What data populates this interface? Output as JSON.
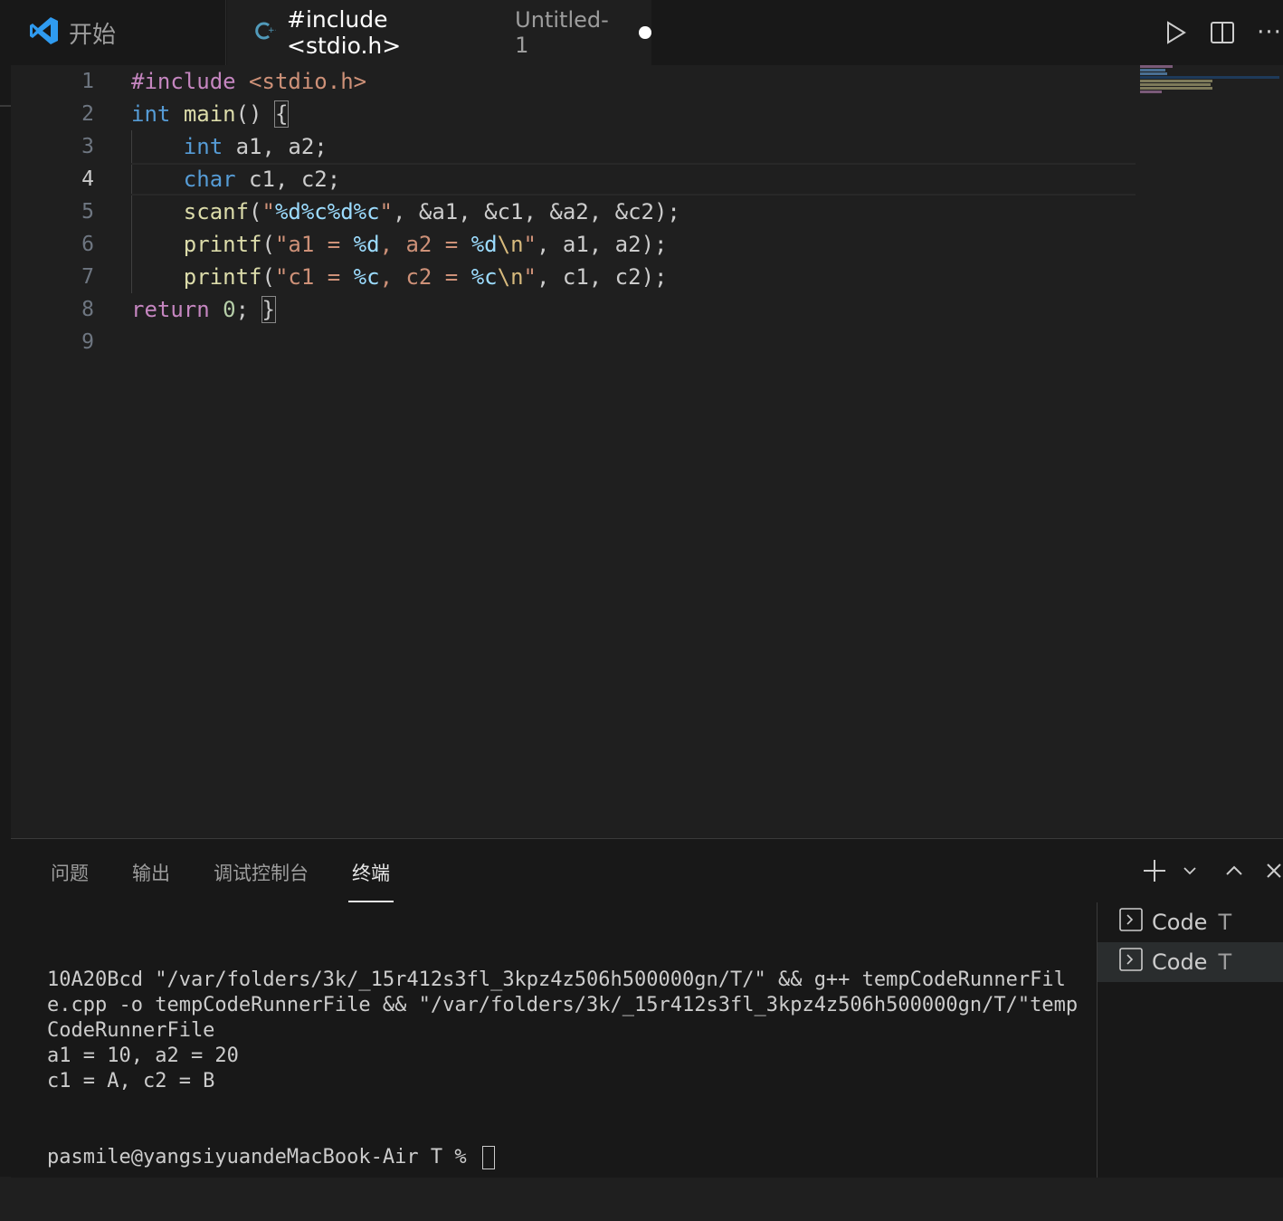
{
  "tabs": {
    "start_label": "开始",
    "file_title": "#include <stdio.h>",
    "file_description": "Untitled-1"
  },
  "editor": {
    "line_numbers": [
      "1",
      "2",
      "3",
      "4",
      "5",
      "6",
      "7",
      "8",
      "9"
    ],
    "active_line": "4",
    "lines": [
      [
        {
          "t": "#include",
          "c": "p"
        },
        {
          "t": " "
        },
        {
          "t": "<stdio.h>",
          "c": "s"
        }
      ],
      [
        {
          "t": "int",
          "c": "k"
        },
        {
          "t": " "
        },
        {
          "t": "main",
          "c": "f"
        },
        {
          "t": "() "
        },
        {
          "t": "{",
          "c": "bm"
        }
      ],
      [
        {
          "t": "    "
        },
        {
          "t": "int",
          "c": "k"
        },
        {
          "t": " a1, a2;"
        }
      ],
      [
        {
          "t": "    "
        },
        {
          "t": "char",
          "c": "k"
        },
        {
          "t": " c1, c2;"
        }
      ],
      [
        {
          "t": "    "
        },
        {
          "t": "scanf",
          "c": "f"
        },
        {
          "t": "("
        },
        {
          "t": "\"",
          "c": "s"
        },
        {
          "t": "%d%c%d%c",
          "c": "fmt"
        },
        {
          "t": "\"",
          "c": "s"
        },
        {
          "t": ", &a1, &c1, &a2, &c2);"
        }
      ],
      [
        {
          "t": "    "
        },
        {
          "t": "printf",
          "c": "f"
        },
        {
          "t": "("
        },
        {
          "t": "\"a1 = ",
          "c": "s"
        },
        {
          "t": "%d",
          "c": "fmt"
        },
        {
          "t": ", a2 = ",
          "c": "s"
        },
        {
          "t": "%d",
          "c": "fmt"
        },
        {
          "t": "\\n",
          "c": "esc"
        },
        {
          "t": "\"",
          "c": "s"
        },
        {
          "t": ", a1, a2);"
        }
      ],
      [
        {
          "t": "    "
        },
        {
          "t": "printf",
          "c": "f"
        },
        {
          "t": "("
        },
        {
          "t": "\"c1 = ",
          "c": "s"
        },
        {
          "t": "%c",
          "c": "fmt"
        },
        {
          "t": ", c2 = ",
          "c": "s"
        },
        {
          "t": "%c",
          "c": "fmt"
        },
        {
          "t": "\\n",
          "c": "esc"
        },
        {
          "t": "\"",
          "c": "s"
        },
        {
          "t": ", c1, c2);"
        }
      ],
      [
        {
          "t": "return",
          "c": "p"
        },
        {
          "t": " "
        },
        {
          "t": "0",
          "c": "n"
        },
        {
          "t": "; "
        },
        {
          "t": "}",
          "c": "bm"
        }
      ],
      []
    ]
  },
  "panel": {
    "tabs": [
      "问题",
      "输出",
      "调试控制台",
      "终端"
    ],
    "active_tab": "终端",
    "terminal_lines": [
      "10A20Bcd \"/var/folders/3k/_15r412s3fl_3kpz4z506h500000gn/T/\" && g++ tempCodeRunnerFile.cpp -o tempCodeRunnerFile && \"/var/folders/3k/_15r412s3fl_3kpz4z506h500000gn/T/\"tempCodeRunnerFile",
      "a1 = 10, a2 = 20",
      "c1 = A, c2 = B"
    ],
    "prompt": "pasmile@yangsiyuandeMacBook-Air T % ",
    "terminal_list": [
      {
        "name": "Code",
        "suffix": "T"
      },
      {
        "name": "Code",
        "suffix": "T"
      }
    ]
  },
  "icons": {
    "logo": "vscode-logo-icon",
    "file_type": "cpp-file-icon",
    "run": "run-icon",
    "split": "split-editor-icon",
    "more": "more-actions-icon",
    "add": "plus-icon",
    "dropdown": "chevron-down-icon",
    "maximize": "chevron-up-icon",
    "close": "close-icon",
    "terminal": "terminal-icon"
  },
  "colors": {
    "accent": "#007acc",
    "keyword": "#569cd6",
    "control": "#c586c0",
    "string": "#ce9178",
    "function": "#dcdcaa"
  }
}
